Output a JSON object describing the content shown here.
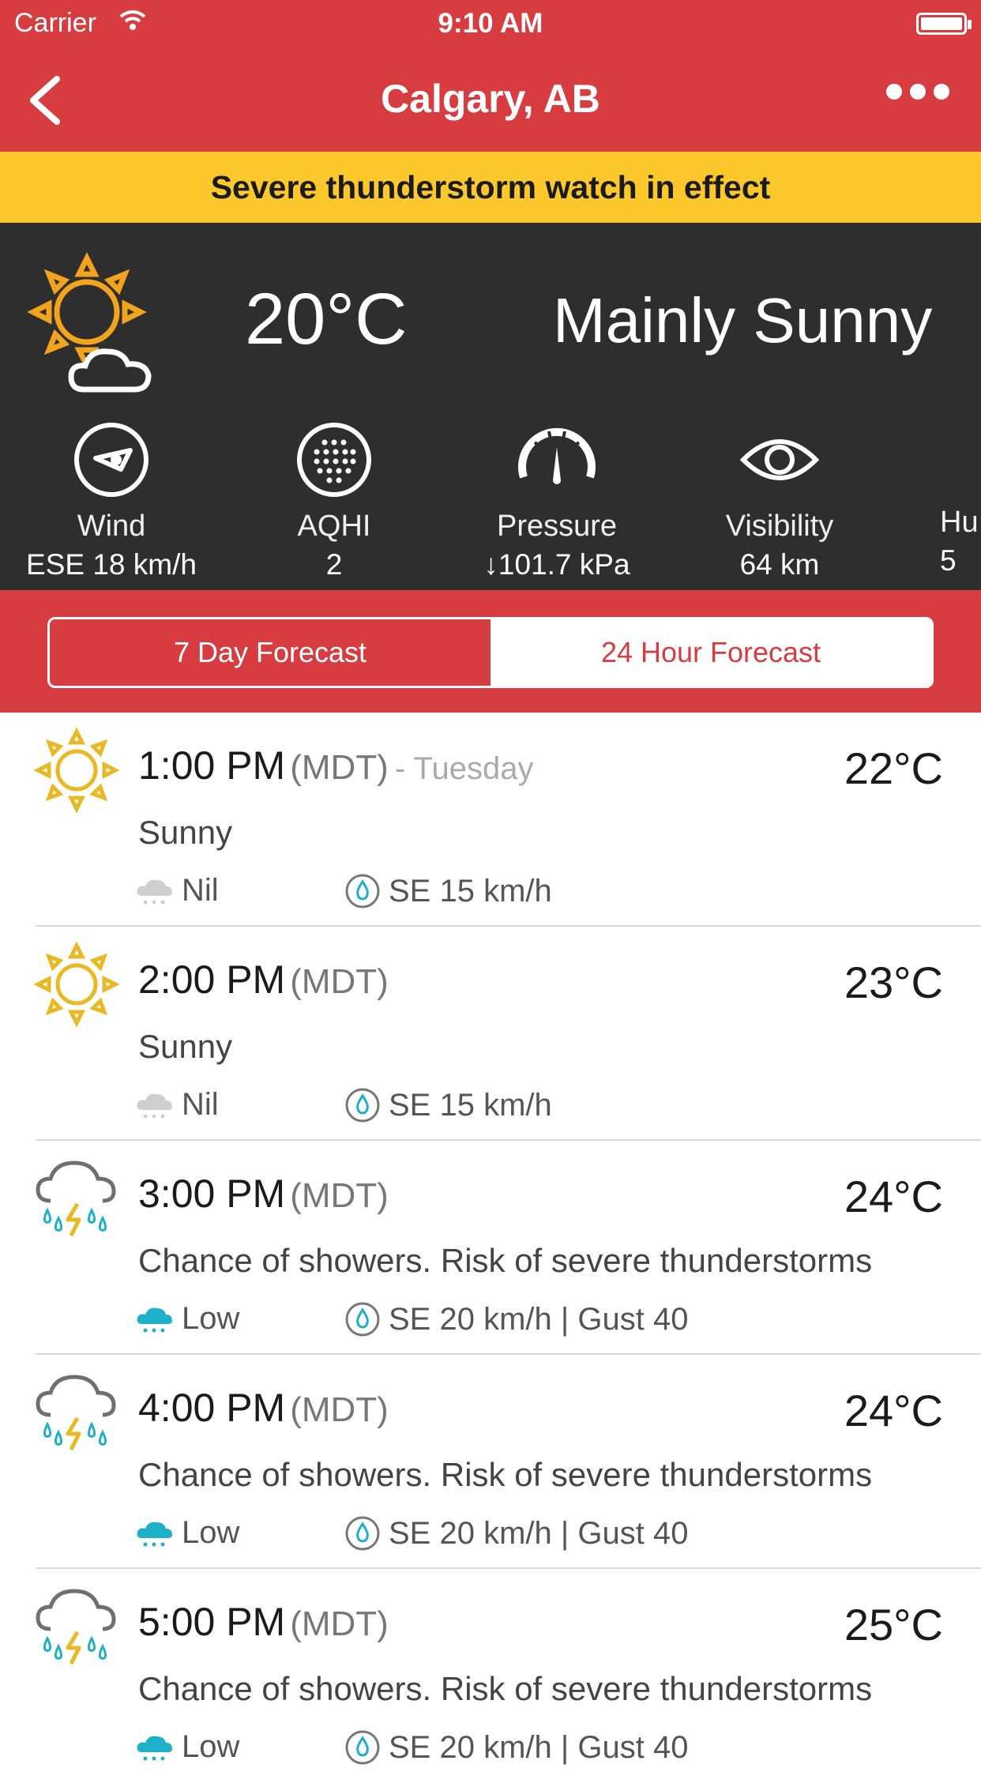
{
  "status": {
    "carrier": "Carrier",
    "time": "9:10 AM"
  },
  "nav": {
    "title": "Calgary, AB"
  },
  "alert": {
    "text": "Severe thunderstorm watch in effect"
  },
  "current": {
    "temp": "20°C",
    "condition": "Mainly Sunny",
    "icon": "sun-cloud-icon",
    "metrics": [
      {
        "label": "Wind",
        "value": "ESE 18 km/h",
        "icon": "wind-icon"
      },
      {
        "label": "AQHI",
        "value": "2",
        "icon": "aqhi-icon"
      },
      {
        "label": "Pressure",
        "value": "↓101.7 kPa",
        "icon": "pressure-gauge-icon"
      },
      {
        "label": "Visibility",
        "value": "64 km",
        "icon": "eye-icon"
      },
      {
        "label": "Hu",
        "value": "5",
        "icon": "humidity-icon"
      }
    ]
  },
  "tabs": {
    "seven_day": "7 Day Forecast",
    "hourly": "24 Hour Forecast"
  },
  "forecast": [
    {
      "time": "1:00 PM",
      "tz": "(MDT)",
      "day": "- Tuesday",
      "temp": "22°C",
      "condition": "Sunny",
      "precip": "Nil",
      "wind": "SE 15 km/h",
      "icon": "sun-icon",
      "precip_icon": "cloud-grey-icon"
    },
    {
      "time": "2:00 PM",
      "tz": "(MDT)",
      "day": "",
      "temp": "23°C",
      "condition": "Sunny",
      "precip": "Nil",
      "wind": "SE 15 km/h",
      "icon": "sun-icon",
      "precip_icon": "cloud-grey-icon"
    },
    {
      "time": "3:00 PM",
      "tz": "(MDT)",
      "day": "",
      "temp": "24°C",
      "condition": "Chance of showers. Risk of severe thunderstorms",
      "precip": "Low",
      "wind": "SE 20 km/h | Gust 40",
      "icon": "thunderstorm-icon",
      "precip_icon": "cloud-blue-icon"
    },
    {
      "time": "4:00 PM",
      "tz": "(MDT)",
      "day": "",
      "temp": "24°C",
      "condition": "Chance of showers. Risk of severe thunderstorms",
      "precip": "Low",
      "wind": "SE 20 km/h | Gust 40",
      "icon": "thunderstorm-icon",
      "precip_icon": "cloud-blue-icon"
    },
    {
      "time": "5:00 PM",
      "tz": "(MDT)",
      "day": "",
      "temp": "25°C",
      "condition": "Chance of showers. Risk of severe thunderstorms",
      "precip": "Low",
      "wind": "SE 20 km/h | Gust 40",
      "icon": "thunderstorm-icon",
      "precip_icon": "cloud-blue-icon"
    }
  ],
  "colors": {
    "brand_red": "#d73c40",
    "alert_yellow": "#fcc82c",
    "panel_dark": "#2e2e2e",
    "sun_gold": "#e8b923",
    "precip_blue": "#1eb0c8"
  }
}
